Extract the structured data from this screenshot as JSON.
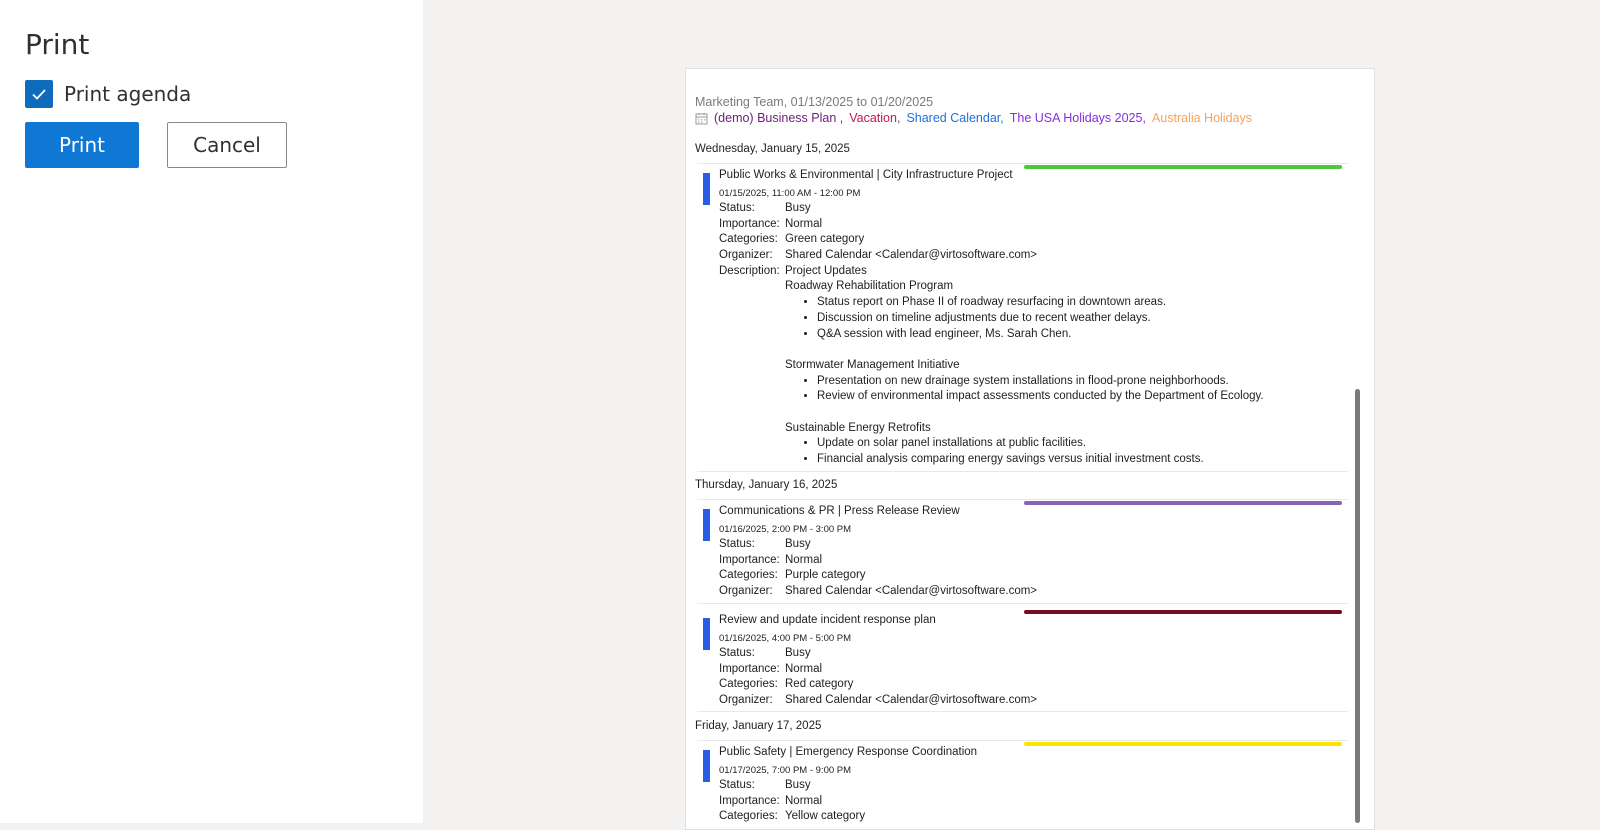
{
  "dialog": {
    "title": "Print",
    "print_agenda_label": "Print agenda",
    "print_agenda_checked": true,
    "print_button": "Print",
    "cancel_button": "Cancel"
  },
  "preview": {
    "header": "Marketing Team, 01/13/2025 to 01/20/2025",
    "calendars": [
      {
        "name": "(demo) Business Plan ,",
        "color": "#6b1f7a"
      },
      {
        "name": "Vacation,",
        "color": "#c2185b"
      },
      {
        "name": "Shared Calendar,",
        "color": "#1e6fd9"
      },
      {
        "name": "The USA Holidays 2025,",
        "color": "#8a2be2"
      },
      {
        "name": "Australia Holidays",
        "color": "#f5a25d"
      }
    ],
    "days": [
      {
        "date": "Wednesday, January 15, 2025",
        "events": [
          {
            "title": "Public Works & Environmental | City Infrastructure Project",
            "time": "01/15/2025, 11:00 AM - 12:00 PM",
            "category_color": "#4cc83a",
            "status_label": "Status:",
            "status": "Busy",
            "importance_label": "Importance:",
            "importance": "Normal",
            "categories_label": "Categories:",
            "categories": "Green category",
            "organizer_label": "Organizer:",
            "organizer": "Shared Calendar <Calendar@virtosoftware.com>",
            "description_label": "Description:",
            "description_first": "Project Updates",
            "description_sections": [
              {
                "heading": "Roadway Rehabilitation Program",
                "bullets": [
                  "Status report on Phase II of roadway resurfacing in downtown areas.",
                  "Discussion on timeline adjustments due to recent weather delays.",
                  "Q&A session with lead engineer, Ms. Sarah Chen."
                ]
              },
              {
                "heading": "Stormwater Management Initiative",
                "bullets": [
                  "Presentation on new drainage system installations in flood-prone neighborhoods.",
                  "Review of environmental impact assessments conducted by the Department of Ecology."
                ]
              },
              {
                "heading": "Sustainable Energy Retrofits",
                "bullets": [
                  "Update on solar panel installations at public facilities.",
                  "Financial analysis comparing energy savings versus initial investment costs."
                ]
              }
            ]
          }
        ]
      },
      {
        "date": "Thursday, January 16, 2025",
        "events": [
          {
            "title": "Communications & PR | Press Release Review",
            "time": "01/16/2025, 2:00 PM - 3:00 PM",
            "category_color": "#8764b8",
            "status_label": "Status:",
            "status": "Busy",
            "importance_label": "Importance:",
            "importance": "Normal",
            "categories_label": "Categories:",
            "categories": "Purple category",
            "organizer_label": "Organizer:",
            "organizer": "Shared Calendar <Calendar@virtosoftware.com>"
          },
          {
            "title": "Review and update incident response plan",
            "time": "01/16/2025, 4:00 PM - 5:00 PM",
            "category_color": "#750b1c",
            "status_label": "Status:",
            "status": "Busy",
            "importance_label": "Importance:",
            "importance": "Normal",
            "categories_label": "Categories:",
            "categories": "Red category",
            "organizer_label": "Organizer:",
            "organizer": "Shared Calendar <Calendar@virtosoftware.com>"
          }
        ]
      },
      {
        "date": "Friday, January 17, 2025",
        "events": [
          {
            "title": "Public Safety | Emergency Response Coordination",
            "time": "01/17/2025, 7:00 PM - 9:00 PM",
            "category_color": "#fde300",
            "status_label": "Status:",
            "status": "Busy",
            "importance_label": "Importance:",
            "importance": "Normal",
            "categories_label": "Categories:",
            "categories": "Yellow category"
          }
        ]
      }
    ]
  }
}
